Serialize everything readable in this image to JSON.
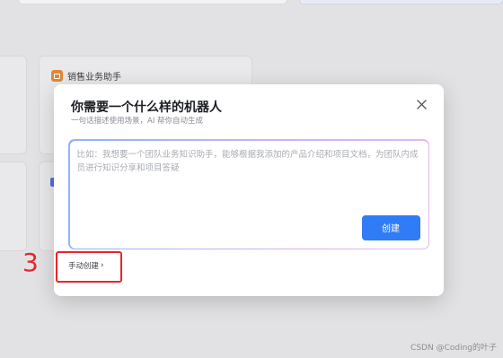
{
  "background": {
    "card_title": "销售业务助手",
    "card_icon": "robot-icon"
  },
  "modal": {
    "title": "你需要一个什么样的机器人",
    "subtitle": "一句话描述使用场景，AI 帮你自动生成",
    "close_icon": "close-icon",
    "prompt": {
      "placeholder": "比如：我想要一个团队业务知识助手，能够根据我添加的产品介绍和项目文档，为团队内成员进行知识分享和项目答疑",
      "value": ""
    },
    "create_label": "创建",
    "manual_create_label": "手动创建",
    "manual_create_chevron": "›"
  },
  "annotation": {
    "number": "3",
    "color": "#e8262b"
  },
  "watermark": "CSDN @Coding的叶子",
  "colors": {
    "primary": "#2f7cf6",
    "annotation": "#e8262b"
  }
}
